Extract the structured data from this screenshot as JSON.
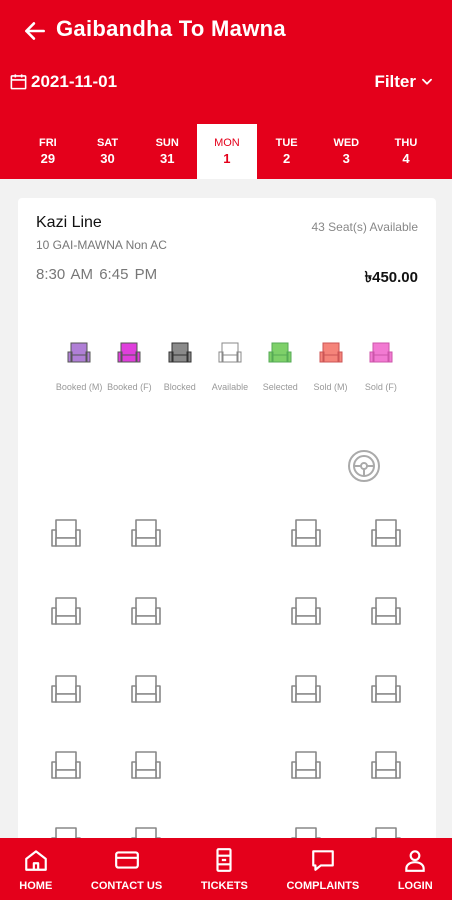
{
  "header": {
    "title": "Gaibandha To Mawna",
    "date": "2021-11-01",
    "filter_label": "Filter"
  },
  "days": [
    {
      "name": "FRI",
      "date": "29",
      "active": false
    },
    {
      "name": "SAT",
      "date": "30",
      "active": false
    },
    {
      "name": "SUN",
      "date": "31",
      "active": false
    },
    {
      "name": "MON",
      "date": "1",
      "active": true
    },
    {
      "name": "TUE",
      "date": "2",
      "active": false
    },
    {
      "name": "WED",
      "date": "3",
      "active": false
    },
    {
      "name": "THU",
      "date": "4",
      "active": false
    }
  ],
  "trip": {
    "operator": "Kazi Line",
    "route": "10 GAI-MAWNA Non AC",
    "seats_available": "43 Seat(s) Available",
    "departure": "8:30 AM",
    "arrival": "6:45 PM",
    "price": "৳450.00"
  },
  "legend": [
    {
      "label": "Booked (M)",
      "color": "#b07fd6"
    },
    {
      "label": "Booked (F)",
      "color": "#df3fdc"
    },
    {
      "label": "Blocked",
      "color": "#8a8a8a"
    },
    {
      "label": "Available",
      "color": "#ffffff"
    },
    {
      "label": "Selected",
      "color": "#7ed069"
    },
    {
      "label": "Sold (M)",
      "color": "#f5847a"
    },
    {
      "label": "Sold (F)",
      "color": "#f27ad2"
    }
  ],
  "bottom_nav": [
    {
      "label": "HOME",
      "icon": "home-icon"
    },
    {
      "label": "CONTACT US",
      "icon": "card-icon"
    },
    {
      "label": "TICKETS",
      "icon": "ticket-icon"
    },
    {
      "label": "COMPLAINTS",
      "icon": "chat-icon"
    },
    {
      "label": "LOGIN",
      "icon": "user-icon"
    }
  ],
  "colors": {
    "brand": "#e4001b",
    "available_seat_stroke": "#888888"
  }
}
